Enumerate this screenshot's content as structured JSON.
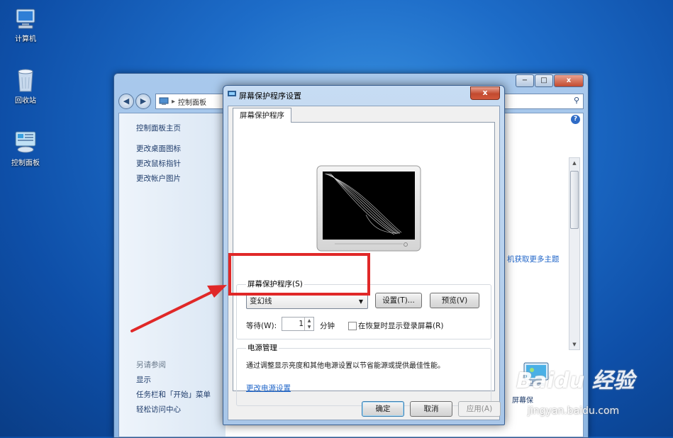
{
  "desktop": {
    "icons": [
      {
        "label": "计算机",
        "icon": "computer-icon"
      },
      {
        "label": "回收站",
        "icon": "recycle-bin-icon"
      },
      {
        "label": "控制面板",
        "icon": "control-panel-icon"
      }
    ]
  },
  "control_panel": {
    "address": {
      "part1": "控制面板"
    },
    "sidebar": {
      "home": "控制面板主页",
      "links": [
        "更改桌面图标",
        "更改鼠标指针",
        "更改帐户图片"
      ],
      "see_also_header": "另请参阅",
      "see_also": [
        "显示",
        "任务栏和「开始」菜单",
        "轻松访问中心"
      ]
    },
    "more_themes_link": "机获取更多主题",
    "display_icon_label": "屏幕保",
    "caption": {
      "minimize": "−",
      "maximize": "□",
      "close": "x"
    }
  },
  "dialog": {
    "title": "屏幕保护程序设置",
    "close_label": "x",
    "tab": "屏幕保护程序",
    "screensaver_group_label": "屏幕保护程序(S)",
    "screensaver_selected": "变幻线",
    "settings_button": "设置(T)...",
    "preview_button": "预览(V)",
    "wait_label": "等待(W):",
    "wait_value": "1",
    "wait_unit": "分钟",
    "resume_checkbox_label": "在恢复时显示登录屏幕(R)",
    "resume_checked": false,
    "power_group_label": "电源管理",
    "power_text": "通过调整显示亮度和其他电源设置以节省能源或提供最佳性能。",
    "power_link": "更改电源设置",
    "ok_button": "确定",
    "cancel_button": "取消",
    "apply_button": "应用(A)"
  },
  "watermark": {
    "brand": "Baidu 经验",
    "site": "jingyan.baidu.com"
  },
  "colors": {
    "highlight_box": "#e02828",
    "link": "#1e64c8"
  }
}
